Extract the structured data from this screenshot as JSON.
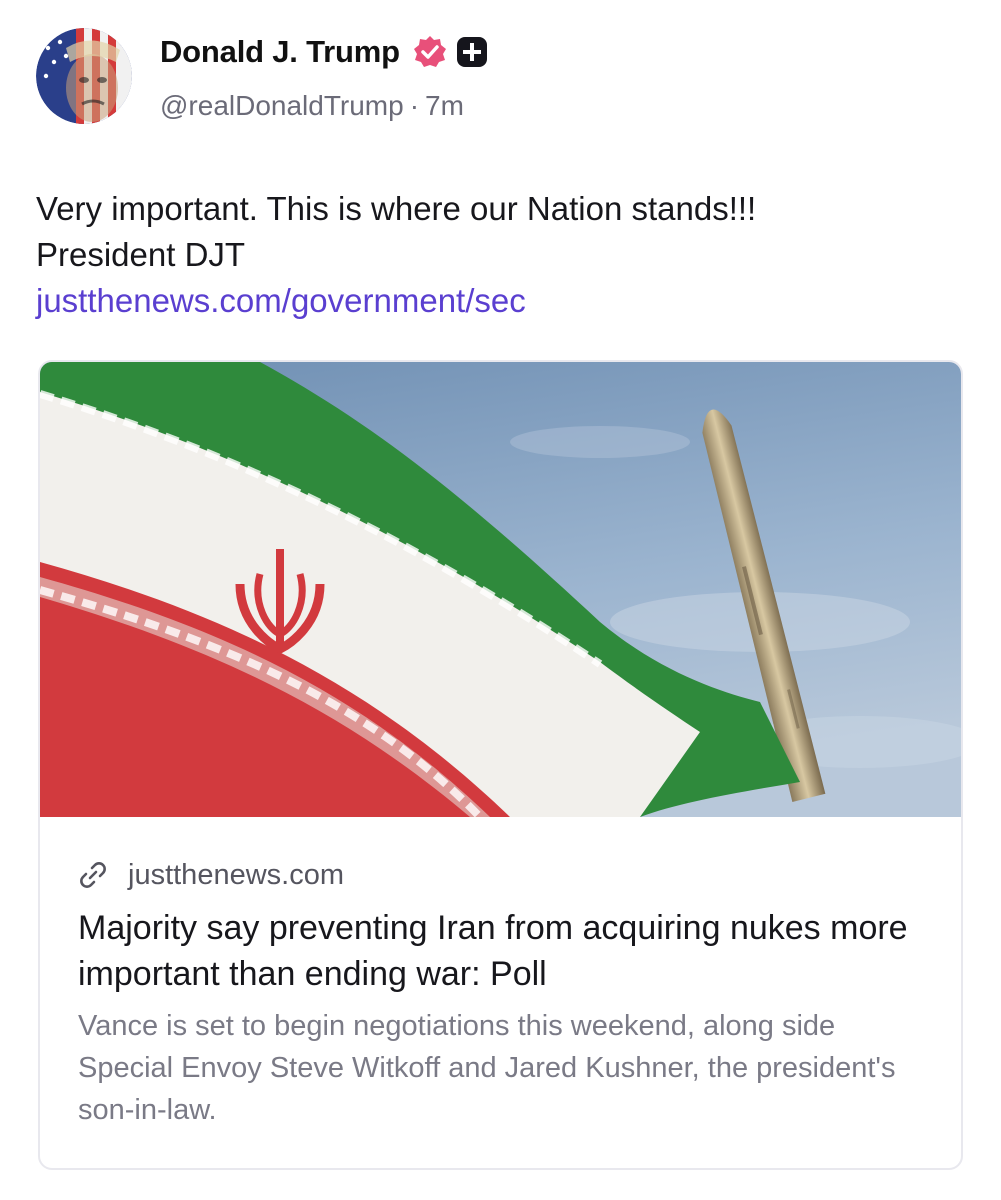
{
  "header": {
    "display_name": "Donald J. Trump",
    "handle": "@realDonaldTrump",
    "separator": "·",
    "time": "7m",
    "avatar_icon": "avatar-flag-portrait",
    "verified_icon": "verified-badge-icon",
    "plus_icon": "plus-badge-icon"
  },
  "post": {
    "text_line1": "Very important. This is where our Nation stands!!!",
    "text_line2": "President DJT",
    "link_text": "justthenews.com/government/sec"
  },
  "card": {
    "image_icon": "iran-flag-missile-photo",
    "domain": "justthenews.com",
    "link_icon": "link-icon",
    "title": "Majority say preventing Iran from acquiring nukes more important than ending war: Poll",
    "description": "Vance is set to begin negotiations this weekend, along side Special Envoy Steve Witkoff and Jared Kushner, the president's son-in-law."
  },
  "colors": {
    "link": "#5a3fd0",
    "verified": "#e8507a",
    "flag_green": "#2f8a3c",
    "flag_red": "#d23a3e",
    "sky": "#8aa6c4"
  }
}
